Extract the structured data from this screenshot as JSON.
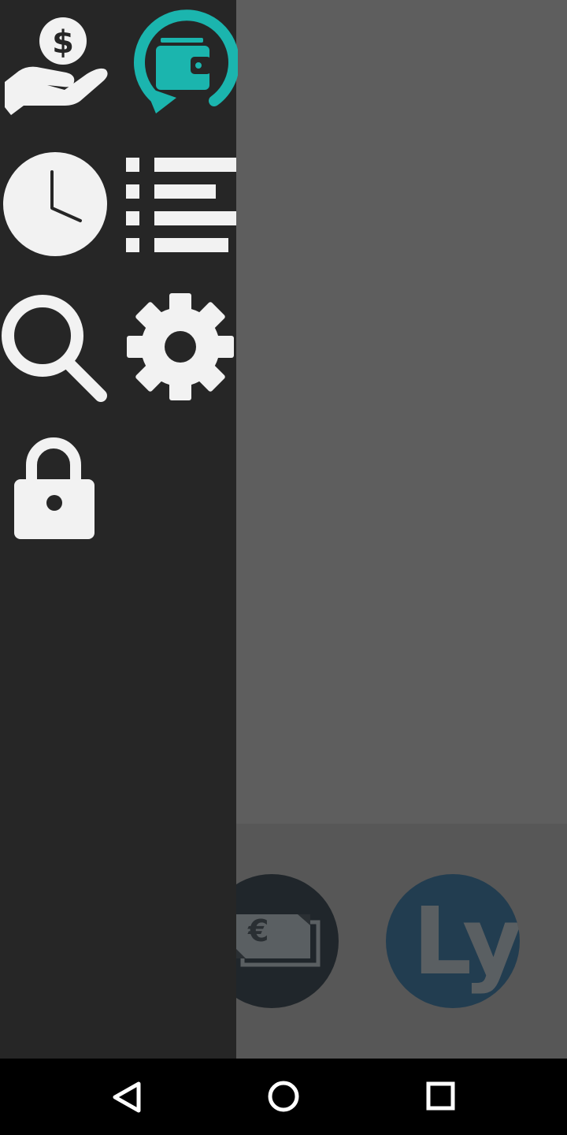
{
  "colors": {
    "drawer_bg": "#262626",
    "scrim": "#5e5e5e",
    "icon_white": "#f2f2f2",
    "accent_teal": "#1bb5ae",
    "nav_bar": "#000000"
  },
  "drawer": {
    "items": [
      {
        "icon": "hand-dollar-icon",
        "action": "income"
      },
      {
        "icon": "wallet-refresh-icon",
        "action": "transfer"
      },
      {
        "icon": "clock-icon",
        "action": "history"
      },
      {
        "icon": "list-icon",
        "action": "list"
      },
      {
        "icon": "search-icon",
        "action": "search"
      },
      {
        "icon": "gear-icon",
        "action": "settings"
      },
      {
        "icon": "lock-icon",
        "action": "lock"
      }
    ],
    "dollar_symbol": "$"
  },
  "background": {
    "cash_currency_symbol": "€",
    "ly_text": "Ly"
  },
  "navbar": {
    "buttons": [
      "back",
      "home",
      "recents"
    ]
  }
}
